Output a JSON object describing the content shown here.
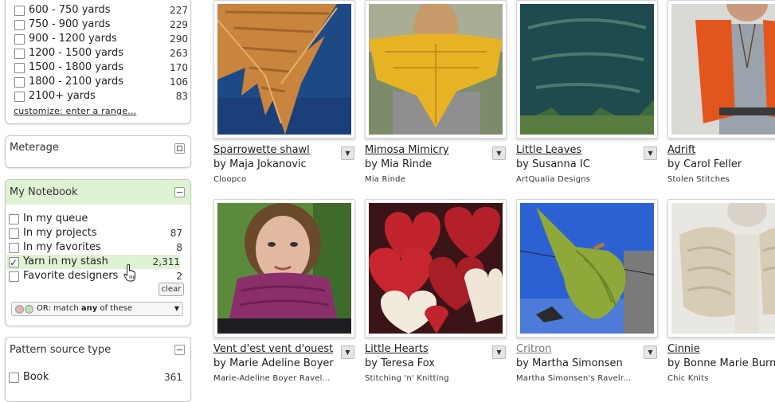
{
  "sidebar": {
    "yardage": {
      "options": [
        {
          "label": "600 - 750 yards",
          "count": "227"
        },
        {
          "label": "750 - 900 yards",
          "count": "229"
        },
        {
          "label": "900 - 1200 yards",
          "count": "290"
        },
        {
          "label": "1200 - 1500 yards",
          "count": "263"
        },
        {
          "label": "1500 - 1800 yards",
          "count": "170"
        },
        {
          "label": "1800 - 2100 yards",
          "count": "106"
        },
        {
          "label": "2100+ yards",
          "count": "83"
        }
      ],
      "customize_link": "customize: enter a range..."
    },
    "meterage": {
      "title": "Meterage"
    },
    "notebook": {
      "title": "My Notebook",
      "options": [
        {
          "label": "In my queue",
          "count": ""
        },
        {
          "label": "In my projects",
          "count": "87"
        },
        {
          "label": "In my favorites",
          "count": "8"
        },
        {
          "label": "Yarn in my stash",
          "count": "2,311"
        },
        {
          "label": "Favorite designers",
          "count": "2"
        }
      ],
      "clear_label": "clear",
      "match_prefix": "OR: match ",
      "match_bold": "any",
      "match_suffix": " of these"
    },
    "source_type": {
      "title": "Pattern source type",
      "options": [
        {
          "label": "Book",
          "count": "361"
        }
      ]
    }
  },
  "patterns": [
    {
      "title": "Sparrowette shawl",
      "designer": "by Maja Jokanovic",
      "source": "Cloopco"
    },
    {
      "title": "Mimosa Mimicry",
      "designer": "by Mia Rinde",
      "source": "Mia Rinde"
    },
    {
      "title": "Little Leaves",
      "designer": "by Susanna IC",
      "source": "ArtQualia Designs"
    },
    {
      "title": "Adrift",
      "designer": "by Carol Feller",
      "source": "Stolen Stitches"
    },
    {
      "title": "Vent d'est vent d'ouest",
      "designer": "by Marie Adeline Boyer",
      "source": "Marie-Adeline Boyer Ravel..."
    },
    {
      "title": "Little Hearts",
      "designer": "by Teresa Fox",
      "source": "Stitching 'n' Knitting"
    },
    {
      "title": "Critron",
      "designer": "by Martha Simonsen",
      "source": "Martha Simonsen's Ravelr..."
    },
    {
      "title": "Cinnie",
      "designer": "by Bonne Marie Burns",
      "source": "Chic Knits"
    }
  ],
  "menu_glyph": "▼",
  "colors": {
    "highlight_green": "#dff2d3",
    "panel_border": "#c9c9c9"
  }
}
